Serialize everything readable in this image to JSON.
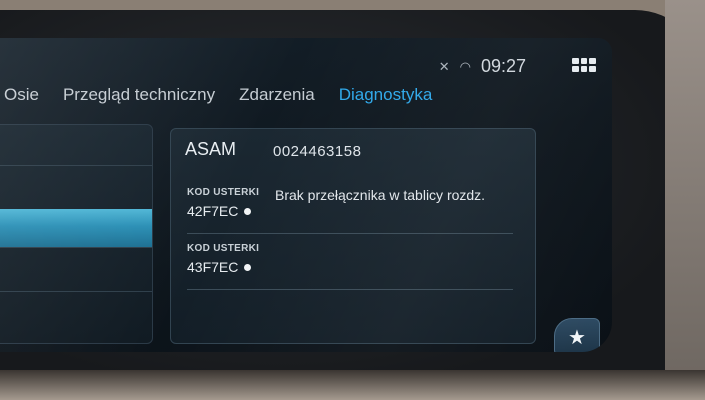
{
  "status": {
    "time": "09:27",
    "icons": [
      "muted-phone-icon",
      "wifi-icon"
    ],
    "menu_icon": "grid-menu-icon"
  },
  "tabs": [
    {
      "label": "Osie",
      "active": false
    },
    {
      "label": "Przegląd techniczny",
      "active": false
    },
    {
      "label": "Zdarzenia",
      "active": false
    },
    {
      "label": "Diagnostyka",
      "active": true
    }
  ],
  "detail": {
    "asam_label": "ASAM",
    "asam_value": "0024463158",
    "faults": [
      {
        "kod_label": "KOD USTERKI",
        "code": "42F7EC",
        "description": "Brak przełącznika w tablicy rozdz."
      },
      {
        "kod_label": "KOD USTERKI",
        "code": "43F7EC",
        "description": ""
      }
    ]
  },
  "favorite_icon": "star-icon",
  "colors": {
    "accent": "#2fa8ea",
    "selection": "#3aa3c8"
  }
}
